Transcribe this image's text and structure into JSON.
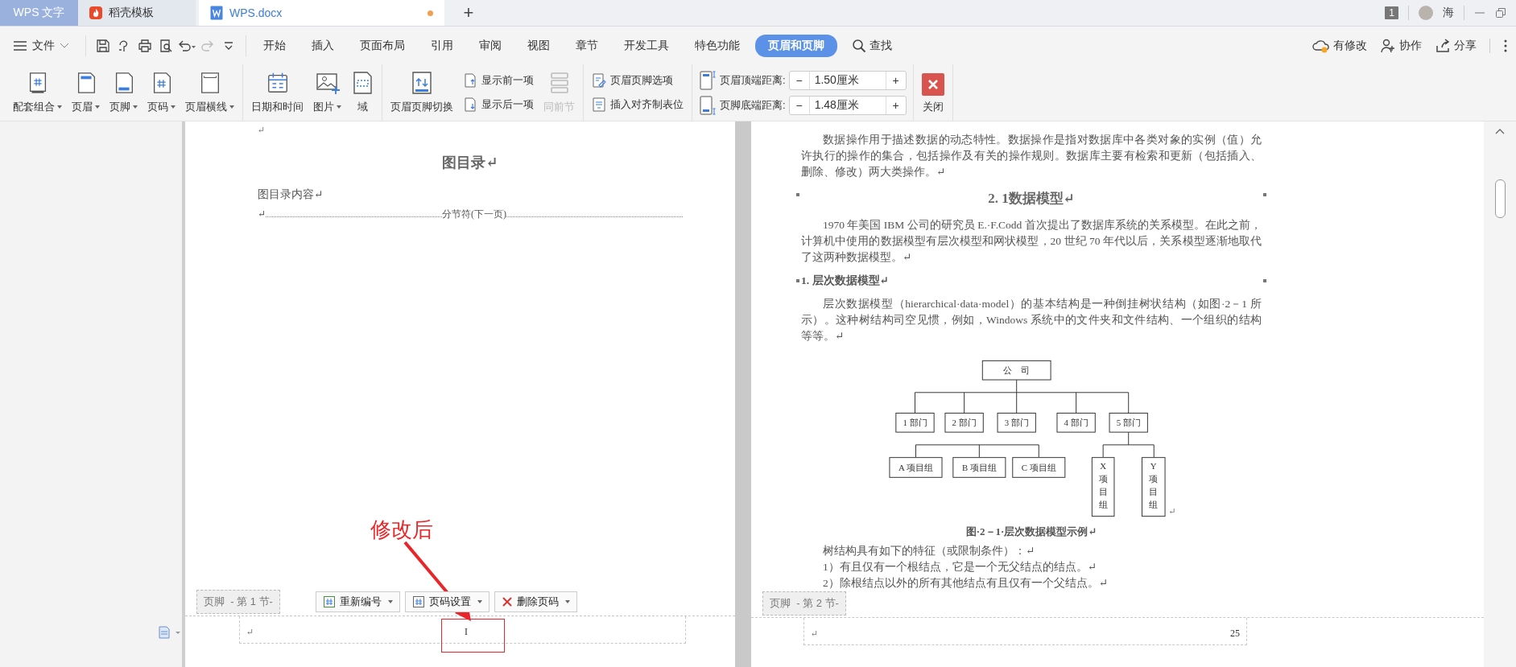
{
  "title_bar": {
    "app_tab": "WPS 文字",
    "tabs": [
      {
        "kind": "template",
        "label": "稻壳模板",
        "selected": false,
        "modified": false
      },
      {
        "kind": "document",
        "label": "WPS.docx",
        "selected": true,
        "modified": true
      }
    ],
    "new_tab": "+",
    "window_count": "1",
    "user_name": "海"
  },
  "menu_bar": {
    "file_menu": "文件",
    "tabs": [
      {
        "label": "开始",
        "selected": false
      },
      {
        "label": "插入",
        "selected": false
      },
      {
        "label": "页面布局",
        "selected": false
      },
      {
        "label": "引用",
        "selected": false
      },
      {
        "label": "审阅",
        "selected": false
      },
      {
        "label": "视图",
        "selected": false
      },
      {
        "label": "章节",
        "selected": false
      },
      {
        "label": "开发工具",
        "selected": false
      },
      {
        "label": "特色功能",
        "selected": false
      },
      {
        "label": "页眉和页脚",
        "selected": true
      }
    ],
    "search": "查找",
    "actions": [
      {
        "kind": "changes",
        "label": "有修改"
      },
      {
        "kind": "collab",
        "label": "协作"
      },
      {
        "kind": "share",
        "label": "分享"
      }
    ]
  },
  "ribbon": {
    "groups": [
      {
        "items": [
          {
            "kind": "combo",
            "label": "配套组合",
            "dropdown": true,
            "disabled": false
          },
          {
            "kind": "header",
            "label": "页眉",
            "dropdown": true,
            "disabled": false
          },
          {
            "kind": "footer",
            "label": "页脚",
            "dropdown": true,
            "disabled": false
          },
          {
            "kind": "page_number",
            "label": "页码",
            "dropdown": true,
            "disabled": false
          },
          {
            "kind": "header_line",
            "label": "页眉横线",
            "dropdown": true,
            "disabled": false
          }
        ]
      },
      {
        "items": [
          {
            "kind": "datetime",
            "label": "日期和时间",
            "dropdown": false,
            "disabled": false
          },
          {
            "kind": "picture",
            "label": "图片",
            "dropdown": true,
            "disabled": false
          },
          {
            "kind": "field",
            "label": "域",
            "dropdown": false,
            "disabled": false
          }
        ]
      },
      {
        "items": [
          {
            "kind": "switch",
            "label": "页眉页脚切换",
            "dropdown": false,
            "disabled": false
          },
          {
            "kind": "stack",
            "items": [
              {
                "kind": "prev",
                "label": "显示前一项"
              },
              {
                "kind": "next",
                "label": "显示后一项"
              }
            ]
          },
          {
            "kind": "same",
            "label": "同前节",
            "dropdown": false,
            "disabled": true
          }
        ]
      },
      {
        "items": [
          {
            "kind": "stack",
            "items": [
              {
                "kind": "options",
                "label": "页眉页脚选项"
              },
              {
                "kind": "tabstop",
                "label": "插入对齐制表位"
              }
            ]
          }
        ]
      },
      {
        "items": [
          {
            "kind": "spinners",
            "items": [
              {
                "kind": "top",
                "label": "页眉顶端距离:",
                "minus": "−",
                "value": "1.50厘米",
                "plus": "+"
              },
              {
                "kind": "bottom",
                "label": "页脚底端距离:",
                "minus": "−",
                "value": "1.48厘米",
                "plus": "+"
              }
            ]
          }
        ]
      },
      {
        "items": [
          {
            "kind": "close",
            "label": "关闭",
            "dropdown": false,
            "disabled": false
          }
        ]
      }
    ]
  },
  "document": {
    "pages": [
      {
        "blocks": [
          {
            "kind": "mark",
            "text": "↵"
          },
          {
            "kind": "title",
            "text": "图目录↵"
          },
          {
            "kind": "plain",
            "text": "图目录内容↵"
          },
          {
            "kind": "section_break",
            "mark": "↵",
            "text": "分节符(下一页)"
          }
        ],
        "footer": {
          "label": "页脚  - 第 1 节-",
          "buttons": [
            {
              "kind": "renumber",
              "label": "重新编号"
            },
            {
              "kind": "settings",
              "label": "页码设置"
            },
            {
              "kind": "delete",
              "label": "删除页码"
            }
          ],
          "mark": "↵",
          "content": "I",
          "kind": "center"
        }
      },
      {
        "blocks": [
          {
            "kind": "para",
            "text": "数据操作用于描述数据的动态特性。数据操作是指对数据库中各类对象的实例（值）允许执行的操作的集合，包括操作及有关的操作规则。数据库主要有检索和更新（包括插入、删除、修改）两大类操作。↵"
          },
          {
            "kind": "heading",
            "text": "2. 1数据模型↵"
          },
          {
            "kind": "para",
            "text": "1970 年美国 IBM 公司的研究员 E.·F.Codd 首次提出了数据库系统的关系模型。在此之前，计算机中使用的数据模型有层次模型和网状模型，20 世纪 70 年代以后，关系模型逐渐地取代了这两种数据模型。↵"
          },
          {
            "kind": "subheading",
            "text": "1. 层次数据模型↵"
          },
          {
            "kind": "para",
            "text": "层次数据模型（hierarchical·data·model）的基本结构是一种倒挂树状结构（如图·2－1 所示）。这种树结构司空见惯，例如，Windows 系统中的文件夹和文件结构、一个组织的结构等等。↵"
          },
          {
            "kind": "figure",
            "mark": "↵",
            "nodes": [
              {
                "label": "公　司",
                "kind": "horizontal"
              },
              {
                "label": "1 部门",
                "kind": "horizontal"
              },
              {
                "label": "2 部门",
                "kind": "horizontal"
              },
              {
                "label": "3 部门",
                "kind": "horizontal"
              },
              {
                "label": "4 部门",
                "kind": "horizontal"
              },
              {
                "label": "5 部门",
                "kind": "horizontal"
              },
              {
                "label": "A 项目组",
                "kind": "horizontal"
              },
              {
                "label": "B 项目组",
                "kind": "horizontal"
              },
              {
                "label": "C 项目组",
                "kind": "horizontal"
              },
              {
                "label": "X项目组",
                "kind": "vertical"
              },
              {
                "label": "Y项目组",
                "kind": "vertical"
              }
            ]
          },
          {
            "kind": "caption",
            "text": "图·2－1·层次数据模型示例↵"
          },
          {
            "kind": "para",
            "text": "树结构具有如下的特征（或限制条件）：↵"
          },
          {
            "kind": "para",
            "text": "1）有且仅有一个根结点，它是一个无父结点的结点。↵"
          },
          {
            "kind": "para",
            "text": "2）除根结点以外的所有其他结点有且仅有一个父结点。↵"
          }
        ],
        "footer": {
          "label": "页脚  - 第 2 节-",
          "mark": "↵",
          "content": "25",
          "kind": "right"
        }
      }
    ]
  },
  "annotation": {
    "text": "修改后"
  }
}
